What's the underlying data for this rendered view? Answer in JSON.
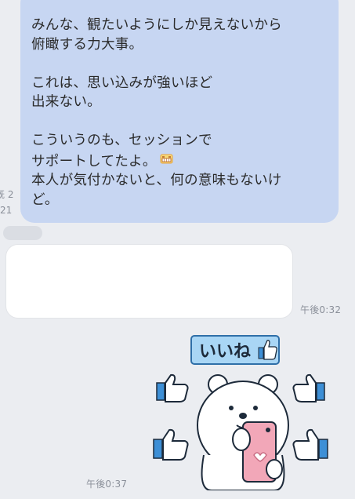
{
  "chat": {
    "outgoing_message": {
      "lines": [
        "みんな、観たいようにしか見えないから",
        "俯瞰する力大事。",
        "これは、思い込みが強いほど",
        "出来ない。",
        "こういうのも、セッションで",
        "サポートしてたよ。",
        "本人が気付かないと、何の意味もないけ",
        "ど。"
      ],
      "emoji": "grinning-face-emoji",
      "read_status_clipped": "既 2",
      "time_clipped": "21"
    },
    "incoming_message": {
      "time": "午後0:32"
    },
    "sticker": {
      "label": "いいね",
      "time": "午後0:37"
    }
  },
  "colors": {
    "background": "#ebedf1",
    "outgoing_bubble": "#c7d6f2",
    "incoming_bubble": "#ffffff",
    "timestamp": "#8a8f99",
    "sticker_blue": "#3d8fd6",
    "sticker_phone": "#f2a7b8"
  }
}
